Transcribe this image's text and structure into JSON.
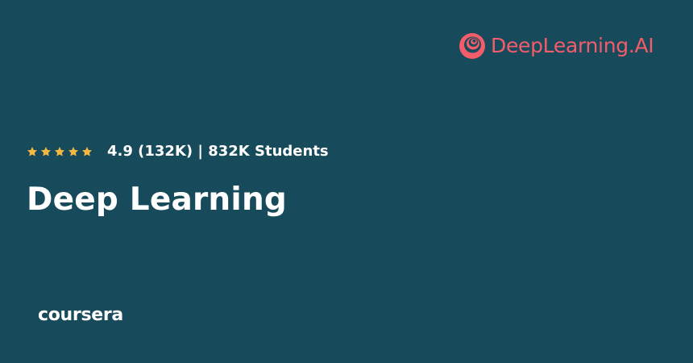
{
  "brand": {
    "name": "DeepLearning.AI",
    "icon": "deeplearning-ai-logo-icon",
    "color": "#f25c6b"
  },
  "course": {
    "rating": 4.9,
    "max_rating": 5,
    "stars_count": 5,
    "star_icon": "star-icon",
    "star_color": "#f5b942",
    "rating_summary": "4.9 (132K) | 832K Students",
    "title": "Deep Learning"
  },
  "footer": {
    "platform_name": "coursera"
  },
  "colors": {
    "background": "#174a5a",
    "text": "#ffffff"
  }
}
